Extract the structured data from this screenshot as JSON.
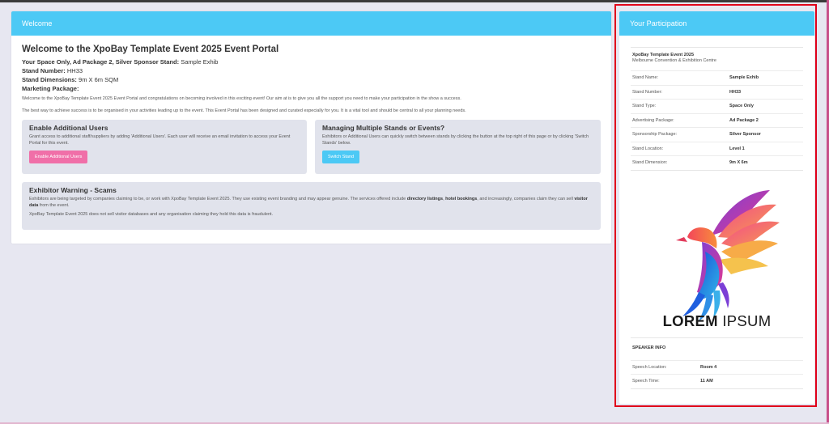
{
  "main": {
    "header": "Welcome",
    "title": "Welcome to the XpoBay Template Event 2025 Event Portal",
    "space_prefix": "Your Space Only, Ad Package 2, Silver Sponsor Stand:",
    "space_value": "Sample Exhib",
    "stand_number_label": "Stand Number:",
    "stand_number_value": "HH33",
    "stand_dimensions_label": "Stand Dimensions:",
    "stand_dimensions_value": "9m X 6m SQM",
    "marketing_label": "Marketing Package:",
    "para1": "Welcome to the XpoBay Template Event 2025 Event Portal and congratulations on becoming involved in this exciting event! Our aim at is to give you all the support you need to make your participation in the show a success.",
    "para2": "The best way to achieve success is to be organised in your activities leading up to the event. This Event Portal has been designed and curated especially for you. It is a vital tool and should be central to all your planning needs."
  },
  "users_panel": {
    "title": "Enable Additional Users",
    "text": "Grant access to additional staff/suppliers by adding 'Additional Users'. Each user will receive an email invitation to access your Event Portal for this event.",
    "button": "Enable Additional Users"
  },
  "stands_panel": {
    "title": "Managing Multiple Stands or Events?",
    "text": "Exhibitors or Additional Users can quickly switch between stands by clicking the button at the top right of this page or by clicking 'Switch Stands' below.",
    "button": "Switch Stand"
  },
  "warning_panel": {
    "title": "Exhibitor Warning - Scams",
    "text_a": "Exhibitors are being targeted by companies claiming to be, or work with XpoBay Template Event 2025. They use existing event branding and may appear genuine. The services offered include ",
    "bold_a": "directory listings",
    "text_b": ", ",
    "bold_b": "hotel bookings",
    "text_c": ", and increasingly, companies claim they can sell ",
    "bold_c": "visitor data",
    "text_d": " from the event.",
    "text2": "XpoBay Template Event 2025 does not sell visitor databases and any organisation claiming they hold this data is fraudulent."
  },
  "participation": {
    "header": "Your Participation",
    "event_name": "XpoBay Template Event 2025",
    "venue": "Melbourne Convention & Exhibition Centre",
    "rows": [
      {
        "label": "Stand Name:",
        "value": "Sample Exhib"
      },
      {
        "label": "Stand Number:",
        "value": "HH33"
      },
      {
        "label": "Stand Type:",
        "value": "Space Only"
      },
      {
        "label": "Advertising Package:",
        "value": "Ad Package 2"
      },
      {
        "label": "Sponsorship Package:",
        "value": "Silver Sponsor"
      },
      {
        "label": "Stand Location:",
        "value": "Level 1"
      },
      {
        "label": "Stand Dimension:",
        "value": "9m X 6m"
      }
    ],
    "logo_word1": "LOREM",
    "logo_word2": "IPSUM",
    "speaker_header": "SPEAKER INFO",
    "speaker_rows": [
      {
        "label": "Speech Location:",
        "value": "Room 4"
      },
      {
        "label": "Speech Time:",
        "value": "11 AM"
      }
    ]
  },
  "colors": {
    "accent": "#4cc9f5",
    "pink_button": "#f06fa8",
    "highlight": "#e0001a",
    "background": "#e7e7f1"
  },
  "icons": [
    "phoenix-bird-logo-icon"
  ]
}
